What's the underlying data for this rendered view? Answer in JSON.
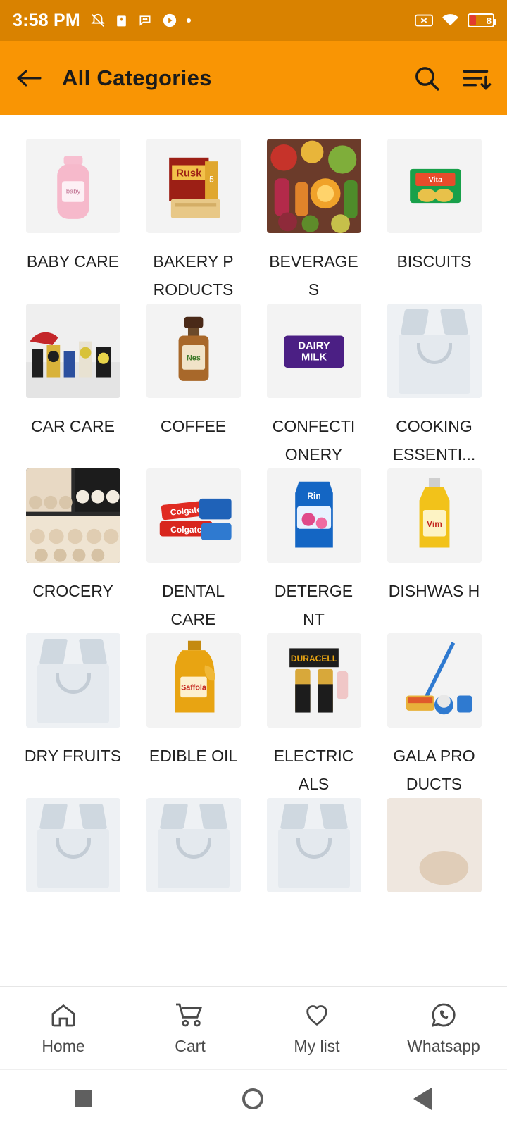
{
  "status_bar": {
    "time": "3:58 PM",
    "left_icons": [
      "bell-off-icon",
      "clipboard-icon",
      "chat-icon",
      "play-circle-icon",
      "dot-icon"
    ],
    "right_icons": [
      "sim-x-icon",
      "wifi-icon",
      "battery-icon"
    ],
    "battery_level": "8"
  },
  "app_bar": {
    "back_icon": "arrow-left-icon",
    "title": "All Categories",
    "search_icon": "search-icon",
    "sort_icon": "sort-descending-icon",
    "background_color": "#f99504"
  },
  "categories": [
    {
      "label": "BABY CARE",
      "art": "bottle"
    },
    {
      "label": "BAKERY P RODUCTS",
      "art": "rusk"
    },
    {
      "label": "BEVERAGE S",
      "art": "produce"
    },
    {
      "label": "BISCUITS",
      "art": "biscuit"
    },
    {
      "label": "CAR CARE",
      "art": "carcare"
    },
    {
      "label": "COFFEE",
      "art": "coffee"
    },
    {
      "label": "CONFECTI ONERY",
      "art": "chocolate"
    },
    {
      "label": "COOKING ESSENTI...",
      "art": "placeholder"
    },
    {
      "label": "CROCERY",
      "art": "shelf"
    },
    {
      "label": "DENTAL CARE",
      "art": "toothpaste"
    },
    {
      "label": "DETERGE NT",
      "art": "detergent"
    },
    {
      "label": "DISHWAS H",
      "art": "dishwash"
    },
    {
      "label": "DRY FRUITS",
      "art": "placeholder"
    },
    {
      "label": "EDIBLE OIL",
      "art": "oil"
    },
    {
      "label": "ELECTRIC ALS",
      "art": "battery"
    },
    {
      "label": "GALA PRO DUCTS",
      "art": "mop"
    },
    {
      "label": "",
      "art": "placeholder"
    },
    {
      "label": "",
      "art": "placeholder"
    },
    {
      "label": "",
      "art": "placeholder"
    },
    {
      "label": "",
      "art": "blank"
    }
  ],
  "bottom_nav": [
    {
      "label": "Home",
      "icon": "home-icon"
    },
    {
      "label": "Cart",
      "icon": "cart-icon"
    },
    {
      "label": "My list",
      "icon": "heart-icon"
    },
    {
      "label": "Whatsapp",
      "icon": "whatsapp-icon"
    }
  ],
  "system_nav": [
    {
      "icon": "recents-square-icon"
    },
    {
      "icon": "home-circle-icon"
    },
    {
      "icon": "back-triangle-icon"
    }
  ]
}
